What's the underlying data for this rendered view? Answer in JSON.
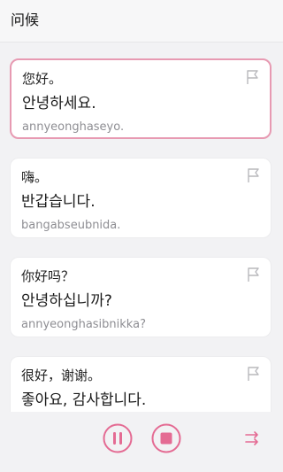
{
  "header": {
    "title": "问候"
  },
  "phrases": [
    {
      "zh": "您好。",
      "ko": "안녕하세요.",
      "rom": "annyeonghaseyo.",
      "active": true
    },
    {
      "zh": "嗨。",
      "ko": "반갑습니다.",
      "rom": "bangabseubnida.",
      "active": false
    },
    {
      "zh": "你好吗？",
      "ko": "안녕하십니까?",
      "rom": "annyeonghasibnikka?",
      "active": false
    },
    {
      "zh": "很好，谢谢。",
      "ko": "좋아요, 감사합니다.",
      "rom": "",
      "active": false
    }
  ],
  "icons": {
    "bookmark": "flag-icon",
    "pause": "pause-icon",
    "stop": "stop-icon",
    "shuffle": "shuffle-icon"
  },
  "colors": {
    "accent": "#e46b93",
    "active_border": "#e79ab2",
    "icon_gray": "#b8b8bc",
    "romanization": "#8e8e93"
  }
}
